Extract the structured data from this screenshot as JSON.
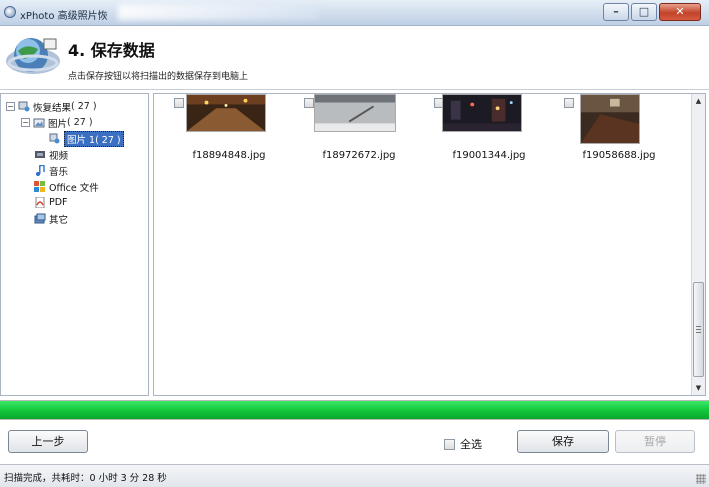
{
  "window": {
    "title": "xPhoto 高级照片恢",
    "minimize_glyph": "–",
    "maximize_glyph": "□",
    "close_glyph": "✕"
  },
  "header": {
    "step_title": "4. 保存数据",
    "step_description": "点击保存按钮以将扫描出的数据保存到电脑上"
  },
  "tree": {
    "root": {
      "label": "恢复结果",
      "count": "( 27 )"
    },
    "pictures": {
      "label": "图片",
      "count": "( 27 )"
    },
    "pictures_sub": {
      "label": "图片 1( 27 )"
    },
    "video": {
      "label": "视频"
    },
    "music": {
      "label": "音乐"
    },
    "office": {
      "label": "Office 文件"
    },
    "pdf": {
      "label": "PDF"
    },
    "other": {
      "label": "其它"
    }
  },
  "files": [
    {
      "name": "f18894848.jpg"
    },
    {
      "name": "f18972672.jpg"
    },
    {
      "name": "f19001344.jpg"
    },
    {
      "name": "f19058688.jpg"
    }
  ],
  "progress": {
    "value_percent": 100,
    "color": "#12c83c"
  },
  "buttons": {
    "back": "上一步",
    "select_all": "全选",
    "save": "保存",
    "pause": "暂停"
  },
  "status": {
    "text": "扫描完成，共耗时：0 小时 3 分 28 秒"
  },
  "icons": {
    "app": "xphoto-app-icon",
    "logo": "globe-logo-icon",
    "tree_root": "recovery-results-icon",
    "pictures": "pictures-folder-icon",
    "video": "video-icon",
    "music": "music-note-icon",
    "office": "office-icon",
    "pdf": "pdf-icon",
    "other": "other-files-icon"
  }
}
